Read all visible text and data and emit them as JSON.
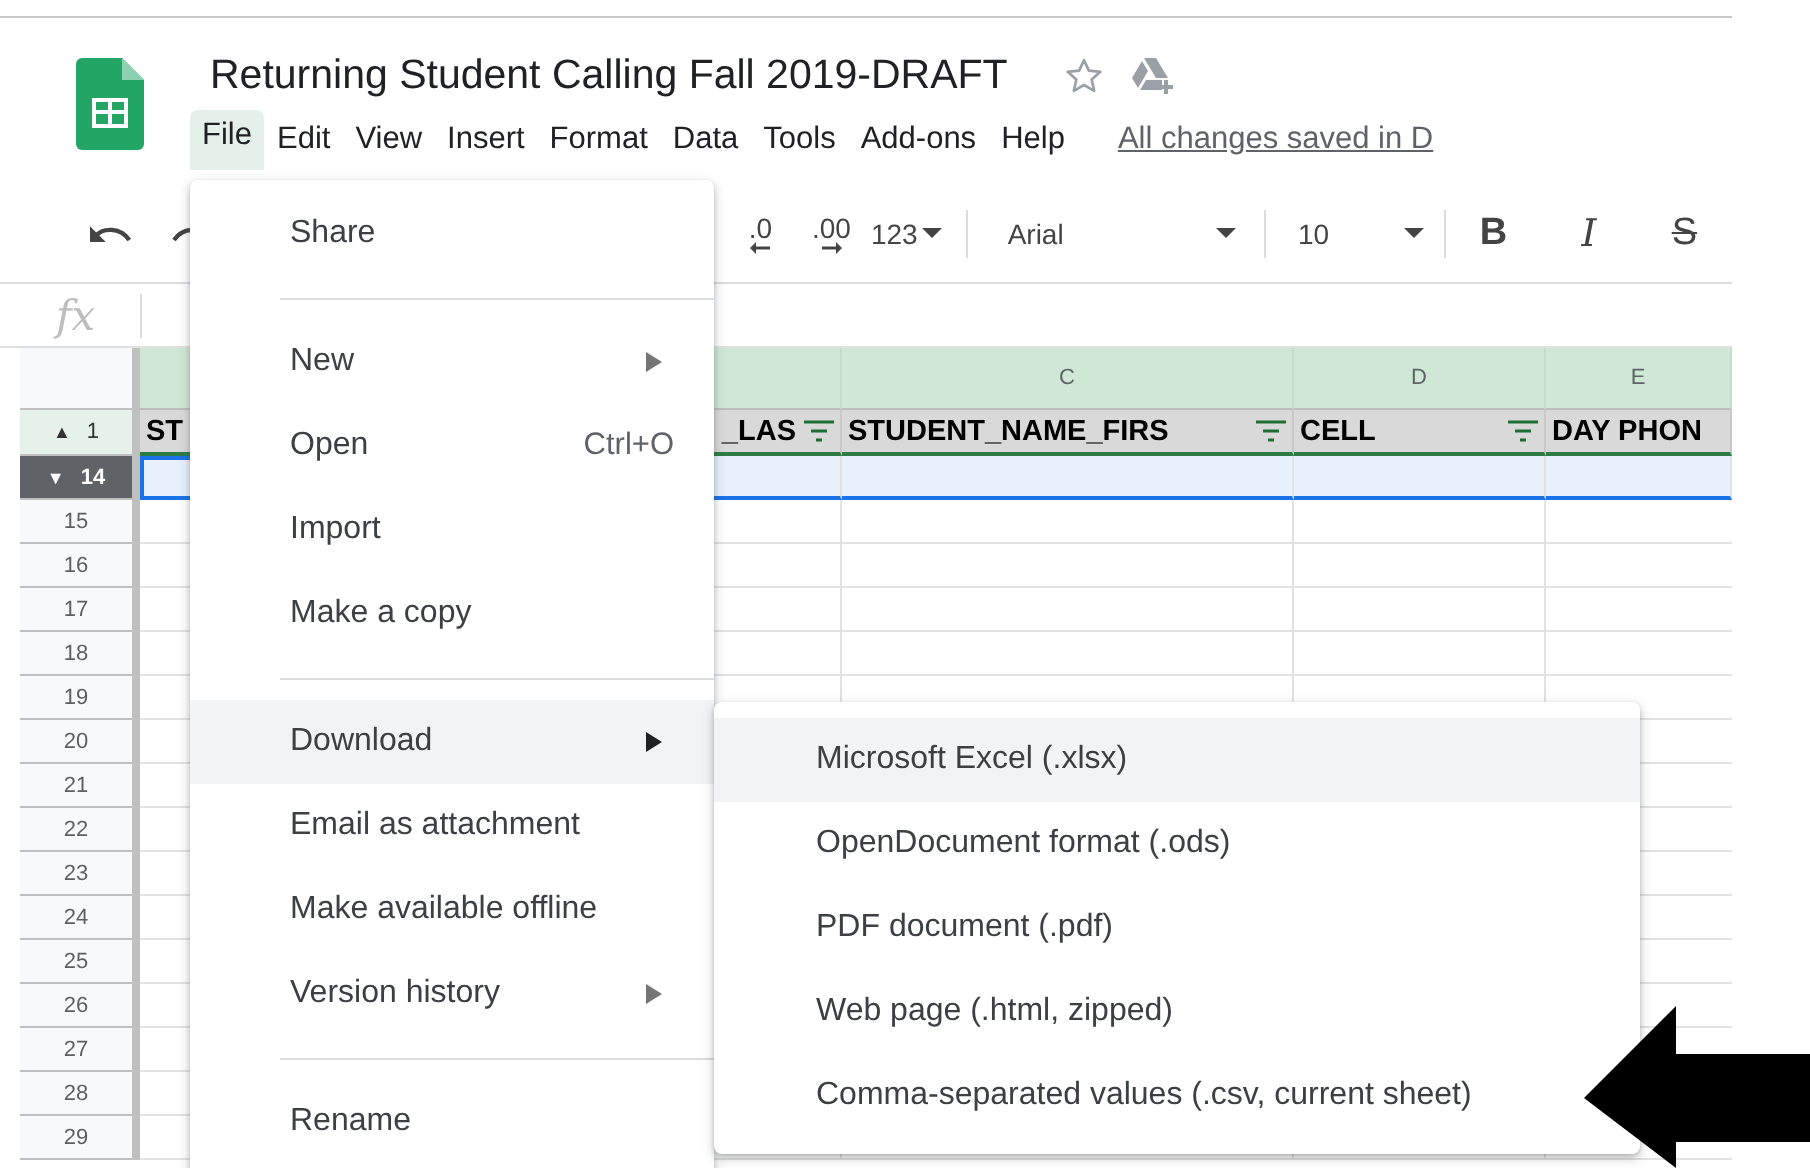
{
  "document": {
    "title": "Returning Student Calling Fall 2019-DRAFT",
    "starred": false
  },
  "menu_bar": [
    {
      "label": "File",
      "selected": true
    },
    {
      "label": "Edit",
      "selected": false
    },
    {
      "label": "View",
      "selected": false
    },
    {
      "label": "Insert",
      "selected": false
    },
    {
      "label": "Format",
      "selected": false
    },
    {
      "label": "Data",
      "selected": false
    },
    {
      "label": "Tools",
      "selected": false
    },
    {
      "label": "Add-ons",
      "selected": false
    },
    {
      "label": "Help",
      "selected": false
    }
  ],
  "save_status": "All changes saved in D",
  "toolbar": {
    "decimal_decrease": ".0",
    "decimal_increase": ".00",
    "number_format": "123",
    "font": "Arial",
    "font_size": "10",
    "format_buttons": [
      {
        "label": "B",
        "kind": "bold"
      },
      {
        "label": "I",
        "kind": "italic"
      },
      {
        "label": "S",
        "kind": "strikethrough"
      }
    ]
  },
  "formula_bar": {
    "label": "fx"
  },
  "sheet": {
    "columns": [
      {
        "header": "ST",
        "filter": false
      },
      {
        "header": "_LAS",
        "filter": true
      },
      {
        "letter": "C",
        "header": "STUDENT_NAME_FIRS",
        "filter": true
      },
      {
        "letter": "D",
        "header": "CELL",
        "filter": true
      },
      {
        "letter": "E",
        "header": "DAY PHON",
        "filter": false
      }
    ],
    "rows": [
      {
        "number": "1",
        "kind": "header",
        "toggle": "▲",
        "selected": false
      },
      {
        "number": "14",
        "kind": "data",
        "toggle": "▼",
        "selected": true
      },
      {
        "number": "15",
        "kind": "data",
        "selected": false
      },
      {
        "number": "16",
        "kind": "data",
        "selected": false
      },
      {
        "number": "17",
        "kind": "data",
        "selected": false
      },
      {
        "number": "18",
        "kind": "data",
        "selected": false
      },
      {
        "number": "19",
        "kind": "data",
        "selected": false
      },
      {
        "number": "20",
        "kind": "data",
        "selected": false
      },
      {
        "number": "21",
        "kind": "data",
        "selected": false
      },
      {
        "number": "22",
        "kind": "data",
        "selected": false
      },
      {
        "number": "23",
        "kind": "data",
        "selected": false
      },
      {
        "number": "24",
        "kind": "data",
        "selected": false
      },
      {
        "number": "25",
        "kind": "data",
        "selected": false
      },
      {
        "number": "26",
        "kind": "data",
        "selected": false
      },
      {
        "number": "27",
        "kind": "data",
        "selected": false
      },
      {
        "number": "28",
        "kind": "data",
        "selected": false
      },
      {
        "number": "29",
        "kind": "data",
        "selected": false
      }
    ]
  },
  "file_menu": [
    {
      "kind": "item",
      "label": "Share",
      "selected": false,
      "submenu": false
    },
    {
      "kind": "divider"
    },
    {
      "kind": "item",
      "label": "New",
      "selected": false,
      "submenu": true
    },
    {
      "kind": "item",
      "label": "Open",
      "shortcut": "Ctrl+O",
      "selected": false,
      "submenu": false
    },
    {
      "kind": "item",
      "label": "Import",
      "selected": false,
      "submenu": false
    },
    {
      "kind": "item",
      "label": "Make a copy",
      "selected": false,
      "submenu": false
    },
    {
      "kind": "divider"
    },
    {
      "kind": "item",
      "label": "Download",
      "selected": true,
      "submenu": true
    },
    {
      "kind": "item",
      "label": "Email as attachment",
      "selected": false,
      "submenu": false
    },
    {
      "kind": "item",
      "label": "Make available offline",
      "selected": false,
      "submenu": false
    },
    {
      "kind": "item",
      "label": "Version history",
      "selected": false,
      "submenu": true
    },
    {
      "kind": "divider"
    },
    {
      "kind": "item",
      "label": "Rename",
      "selected": false,
      "submenu": false
    }
  ],
  "download_menu": [
    {
      "kind": "item",
      "label": "Microsoft Excel (.xlsx)",
      "selected": true,
      "submenu": false
    },
    {
      "kind": "item",
      "label": "OpenDocument format (.ods)",
      "selected": false,
      "submenu": false
    },
    {
      "kind": "item",
      "label": "PDF document (.pdf)",
      "selected": false,
      "submenu": false
    },
    {
      "kind": "item",
      "label": "Web page (.html, zipped)",
      "selected": false,
      "submenu": false
    },
    {
      "kind": "item",
      "label": "Comma-separated values (.csv, current sheet)",
      "selected": false,
      "submenu": false
    }
  ]
}
